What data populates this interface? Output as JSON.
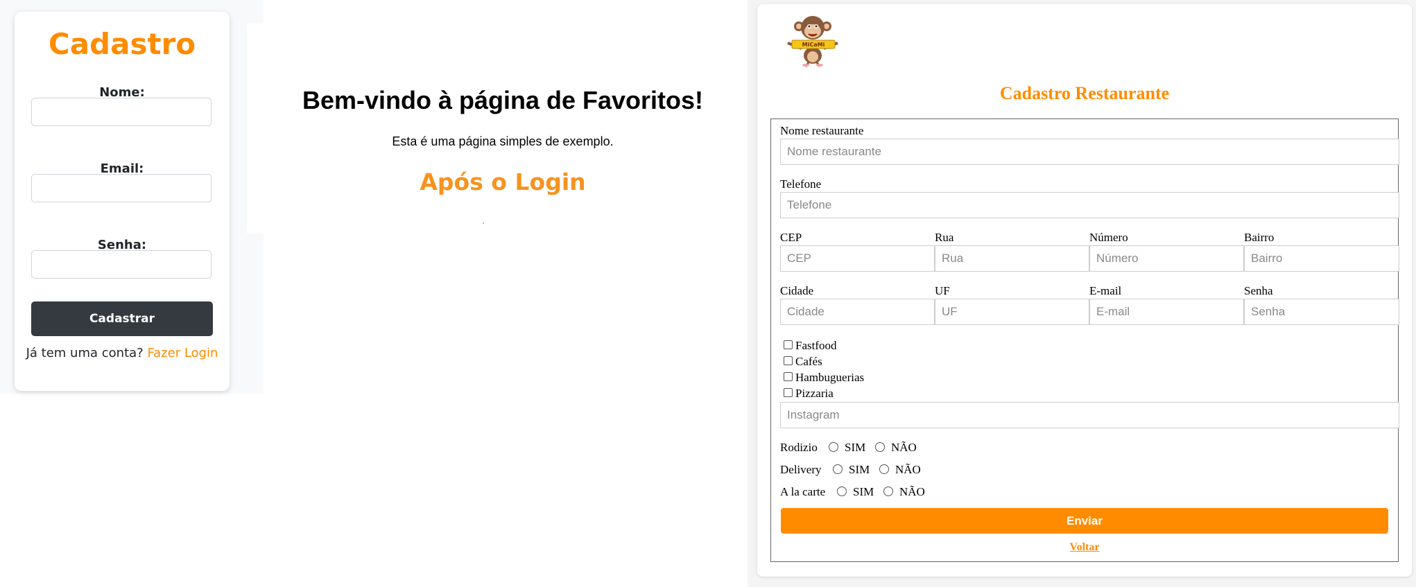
{
  "signup": {
    "title": "Cadastro",
    "name_label": "Nome:",
    "email_label": "Email:",
    "password_label": "Senha:",
    "submit_label": "Cadastrar",
    "login_prompt": "Já tem uma conta?",
    "login_link": "Fazer Login"
  },
  "favorites": {
    "title": "Bem-vindo à página de Favoritos!",
    "subtitle": "Esta é uma página simples de exemplo.",
    "after_login": "Após o Login"
  },
  "restaurant": {
    "logo_text": "MiCaMi",
    "title": "Cadastro Restaurante",
    "fields": {
      "nome": {
        "label": "Nome restaurante",
        "placeholder": "Nome restaurante"
      },
      "telefone": {
        "label": "Telefone",
        "placeholder": "Telefone"
      },
      "cep": {
        "label": "CEP",
        "placeholder": "CEP"
      },
      "rua": {
        "label": "Rua",
        "placeholder": "Rua"
      },
      "numero": {
        "label": "Número",
        "placeholder": "Número"
      },
      "bairro": {
        "label": "Bairro",
        "placeholder": "Bairro"
      },
      "cidade": {
        "label": "Cidade",
        "placeholder": "Cidade"
      },
      "uf": {
        "label": "UF",
        "placeholder": "UF"
      },
      "email": {
        "label": "E-mail",
        "placeholder": "E-mail"
      },
      "senha": {
        "label": "Senha",
        "placeholder": "Senha"
      },
      "instagram": {
        "placeholder": "Instagram"
      }
    },
    "categories": [
      "Fastfood",
      "Cafés",
      "Hambuguerias",
      "Pizzaria"
    ],
    "options": {
      "rodizio": {
        "label": "Rodizio",
        "yes": "SIM",
        "no": "NÃO"
      },
      "delivery": {
        "label": "Delivery",
        "yes": "SIM",
        "no": "NÃO"
      },
      "alacarte": {
        "label": "A la carte",
        "yes": "SIM",
        "no": "NÃO"
      }
    },
    "submit_label": "Enviar",
    "back_label": "Voltar"
  },
  "colors": {
    "accent": "#ff8c00",
    "dark_button": "#343a40"
  }
}
